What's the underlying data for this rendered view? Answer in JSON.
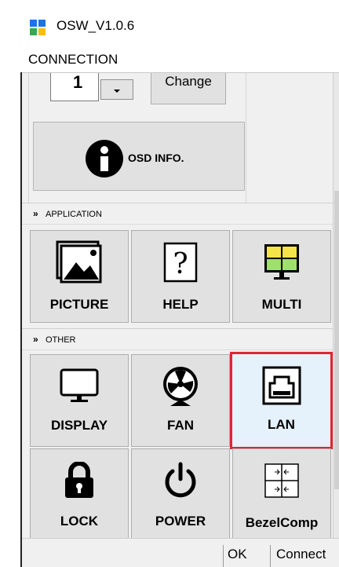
{
  "window": {
    "title": "OSW_V1.0.6"
  },
  "menu": {
    "items": [
      {
        "label": "CONNECTION"
      }
    ]
  },
  "connection": {
    "id_value": "1",
    "change_label": "Change",
    "osd_info_label": "OSD INFO."
  },
  "sections": {
    "application": {
      "header": "APPLICATION",
      "tiles": [
        {
          "label": "PICTURE",
          "icon": "picture-icon"
        },
        {
          "label": "HELP",
          "icon": "help-icon"
        },
        {
          "label": "MULTI",
          "icon": "multi-screen-icon"
        }
      ]
    },
    "other": {
      "header": "OTHER",
      "tiles": [
        {
          "label": "DISPLAY",
          "icon": "monitor-icon"
        },
        {
          "label": "FAN",
          "icon": "fan-icon"
        },
        {
          "label": "LAN",
          "icon": "ethernet-icon",
          "selected": true
        },
        {
          "label": "LOCK",
          "icon": "lock-icon"
        },
        {
          "label": "POWER",
          "icon": "power-icon"
        },
        {
          "label": "BezelComp",
          "icon": "bezel-grid-icon"
        }
      ]
    }
  },
  "status": {
    "result": "OK",
    "connection": "Connect"
  },
  "colors": {
    "selection_border": "#e0262d",
    "selected_fill": "#e5f1fb",
    "tile_fill": "#e1e1e1"
  }
}
